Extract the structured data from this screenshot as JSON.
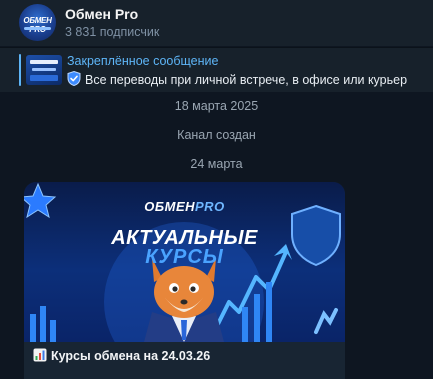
{
  "channel": {
    "name": "Обмен Pro",
    "subscribers": "3 831 подписчик",
    "avatar_logo": "ОБМЕН PRO"
  },
  "pinned": {
    "title": "Закреплённое сообщение",
    "text": "Все переводы при личной встрече, в офисе или курьер"
  },
  "timeline": {
    "date1": "18 марта 2025",
    "service": "Канал создан",
    "date2": "24 марта"
  },
  "post": {
    "brand_main": "ОБМЕН",
    "brand_accent": "PRO",
    "headline_line1": "АКТУАЛЬНЫЕ",
    "headline_line2": "КУРСЫ",
    "caption": "Курсы обмена на 24.03.26"
  },
  "colors": {
    "background": "#0e1621",
    "panel": "#17212b",
    "accent": "#5eb5f7",
    "muted": "#7f91a4"
  },
  "icons": [
    "shield-emoji-icon",
    "chart-emoji-icon"
  ]
}
